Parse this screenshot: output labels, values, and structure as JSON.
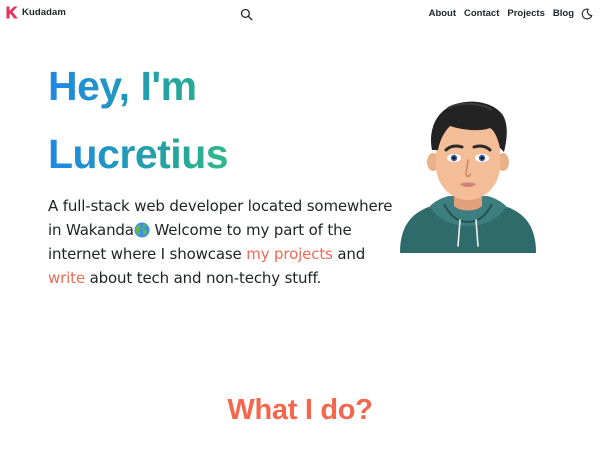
{
  "nav": {
    "brand": "Kudadam",
    "links": [
      "About",
      "Contact",
      "Projects",
      "Blog"
    ]
  },
  "hero": {
    "title_line1": "Hey, I'm",
    "title_line2": "Lucretius",
    "intro_part1": "A full-stack web developer located somewhere in Wakanda",
    "intro_part2": " Welcome to my part of the internet where I showcase ",
    "projects_link": "my projects",
    "intro_part3": " and ",
    "write_link": "write",
    "intro_part4": " about tech and non-techy stuff."
  },
  "sections": {
    "what_i_do": "What I do?"
  },
  "colors": {
    "accent": "#f4674c",
    "brand": "#e5325c",
    "gradient_start": "#1e88e5",
    "gradient_end": "#3ed07b"
  },
  "icons": {
    "brand": "k-logo-icon",
    "search": "search-icon",
    "theme": "moon-icon",
    "globe": "globe-icon"
  }
}
